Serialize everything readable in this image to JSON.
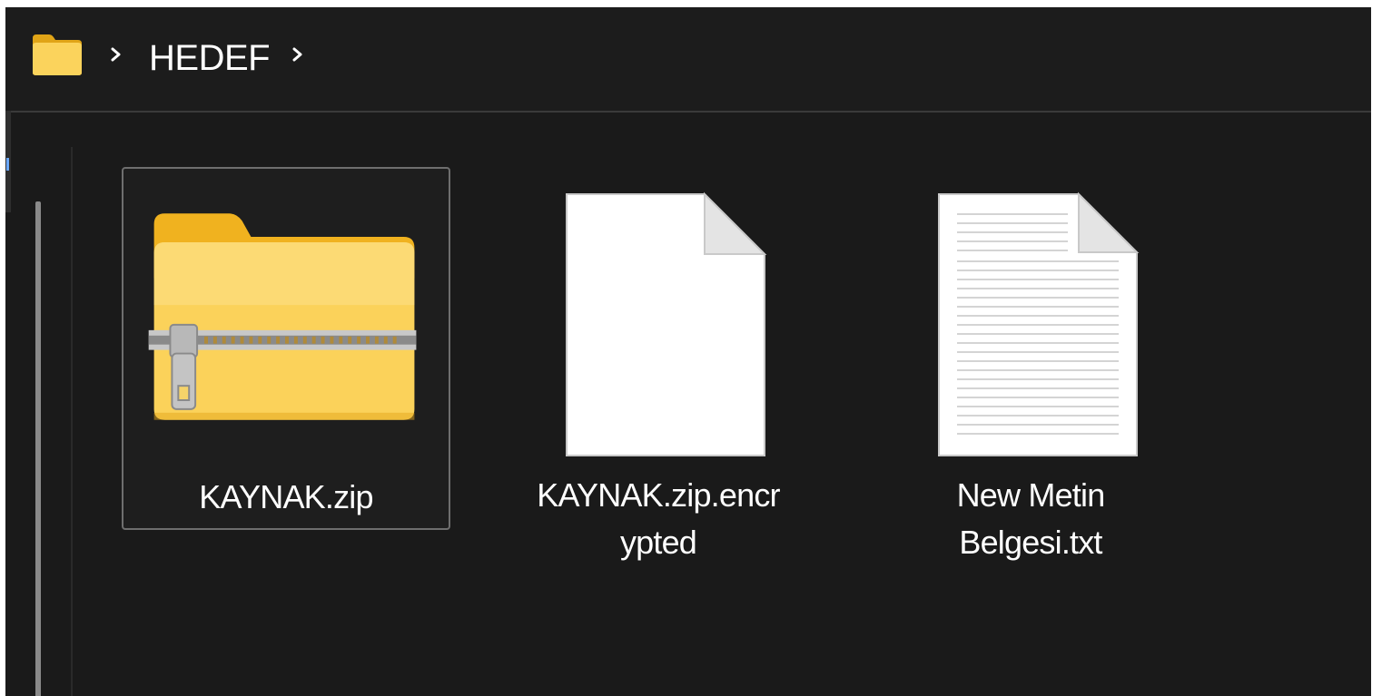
{
  "breadcrumb": {
    "current_folder": "HEDEF"
  },
  "files": [
    {
      "name": "KAYNAK.zip",
      "icon": "zip-folder-icon",
      "selected": true
    },
    {
      "name_line1": "KAYNAK.zip.encr",
      "name_line2": "ypted",
      "icon": "blank-file-icon",
      "selected": false
    },
    {
      "name_line1": "New Metin",
      "name_line2": "Belgesi.txt",
      "icon": "text-file-icon",
      "selected": false
    }
  ],
  "colors": {
    "background": "#1a1a1a",
    "text": "#ffffff",
    "folder_yellow": "#f8c843",
    "selection_border": "#6e6e6e"
  }
}
